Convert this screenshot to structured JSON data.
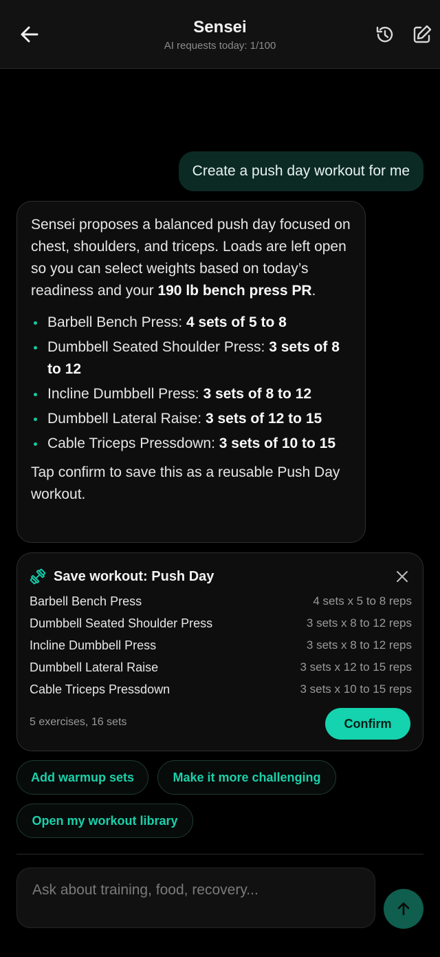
{
  "header": {
    "title": "Sensei",
    "subtitle": "AI requests today: 1/100",
    "icons": [
      "back-arrow-icon",
      "history-icon",
      "edit-icon"
    ]
  },
  "user_message": "Create a push day workout for me",
  "ai_message": {
    "intro_text_1": "Sensei proposes a balanced push day focused on chest, shoulders, and triceps. Loads are left open so you can select weights based on today’s readiness and your ",
    "intro_bold": "190 lb bench press PR",
    "intro_end": ".",
    "bullets": [
      {
        "name": "Barbell Bench Press: ",
        "detail": "4 sets of 5 to 8"
      },
      {
        "name": "Dumbbell Seated Shoulder Press: ",
        "detail": "3 sets of 8 to 12"
      },
      {
        "name": "Incline Dumbbell Press: ",
        "detail": "3 sets of 8 to 12"
      },
      {
        "name": "Dumbbell Lateral Raise: ",
        "detail": "3 sets of 12 to 15"
      },
      {
        "name": "Cable Triceps Pressdown: ",
        "detail": "3 sets of 10 to 15"
      }
    ],
    "outro": "Tap confirm to save this as a reusable Push Day workout."
  },
  "save_card": {
    "title": "Save workout: Push Day",
    "exercises": [
      {
        "name": "Barbell Bench Press",
        "sets": "4 sets x 5 to 8 reps"
      },
      {
        "name": "Dumbbell Seated Shoulder Press",
        "sets": "3 sets x 8 to 12 reps"
      },
      {
        "name": "Incline Dumbbell Press",
        "sets": "3 sets x 8 to 12 reps"
      },
      {
        "name": "Dumbbell Lateral Raise",
        "sets": "3 sets x 12 to 15 reps"
      },
      {
        "name": "Cable Triceps Pressdown",
        "sets": "3 sets x 10 to 15 reps"
      }
    ],
    "summary": "5 exercises, 16 sets",
    "confirm_label": "Confirm"
  },
  "suggestions": [
    "Add warmup sets",
    "Make it more challenging",
    "Open my workout library"
  ],
  "composer": {
    "placeholder": "Ask about training, food, recovery...",
    "value": ""
  },
  "colors": {
    "accent": "#14d3ae",
    "user_bubble": "#0c2a24",
    "send_button": "#0f5e4e"
  }
}
